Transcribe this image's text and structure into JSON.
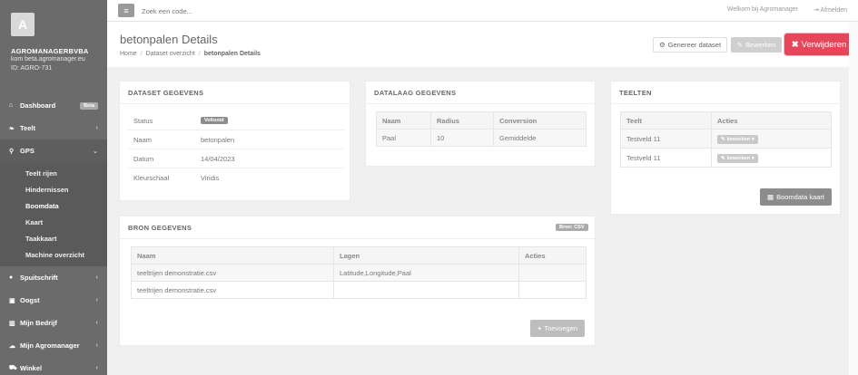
{
  "sidebar": {
    "logo_letter": "A",
    "company_name": "AGROMANAGERBVBA",
    "company_url": "kom beta.agromanager.eu",
    "company_id": "ID: AGRO-731",
    "items": [
      {
        "label": "Dashboard",
        "icon": "home-icon",
        "badge": "Beta"
      },
      {
        "label": "Teelt",
        "icon": "leaf-icon"
      },
      {
        "label": "GPS",
        "icon": "map-marker-icon"
      },
      {
        "label": "Spuitschrift",
        "icon": "drop-icon"
      },
      {
        "label": "Oogst",
        "icon": "basket-icon"
      },
      {
        "label": "Mijn Bedrijf",
        "icon": "chart-icon"
      },
      {
        "label": "Mijn Agromanager",
        "icon": "cloud-icon"
      },
      {
        "label": "Winkel",
        "icon": "cart-icon"
      }
    ],
    "gps_sub": [
      "Teelt rijen",
      "Hindernissen",
      "Boomdata",
      "Kaart",
      "Taakkaart",
      "Machine overzicht"
    ]
  },
  "topbar": {
    "search_placeholder": "Zoek een code...",
    "welcome": "Welkom bij Agromanager",
    "logout": "Afmelden"
  },
  "header": {
    "title": "betonpalen Details",
    "breadcrumb": [
      "Home",
      "Dataset overzicht",
      "betonpalen Details"
    ],
    "generate_label": "Genereer dataset",
    "edit_label": "Bewerken",
    "delete_label": "Verwijderen"
  },
  "dataset": {
    "title": "DATASET GEGEVENS",
    "rows": [
      {
        "key": "Status",
        "value": "Voltooid"
      },
      {
        "key": "Naam",
        "value": "betonpalen"
      },
      {
        "key": "Datum",
        "value": "14/04/2023"
      },
      {
        "key": "Kleurschaal",
        "value": "Viridis"
      }
    ]
  },
  "datalaag": {
    "title": "DATALAAG GEGEVENS",
    "columns": [
      "Naam",
      "Radius",
      "Conversion"
    ],
    "rows": [
      [
        "Paal",
        "10",
        "Gemiddelde"
      ]
    ]
  },
  "teelten": {
    "title": "TEELTEN",
    "columns": [
      "Teelt",
      "Acties"
    ],
    "rows": [
      {
        "teelt": "Testveld 11",
        "action": "bewerken"
      },
      {
        "teelt": "Testveld 11",
        "action": "bewerken"
      }
    ],
    "map_button": "Boomdata kaart"
  },
  "bron": {
    "title": "BRON GEGEVENS",
    "badge": "Bron: CSV",
    "columns": [
      "Naam",
      "Lagen",
      "Acties"
    ],
    "rows": [
      [
        "teeltrijen demonstratie.csv",
        "Latitude,Longitude,Paal",
        ""
      ],
      [
        "teeltrijen demonstratie.csv",
        "",
        ""
      ]
    ],
    "add_button": "Toevoegen"
  },
  "colors": {
    "sidebar": "#6b6b6b",
    "danger": "#e5475a",
    "background": "#f0f0f0"
  }
}
